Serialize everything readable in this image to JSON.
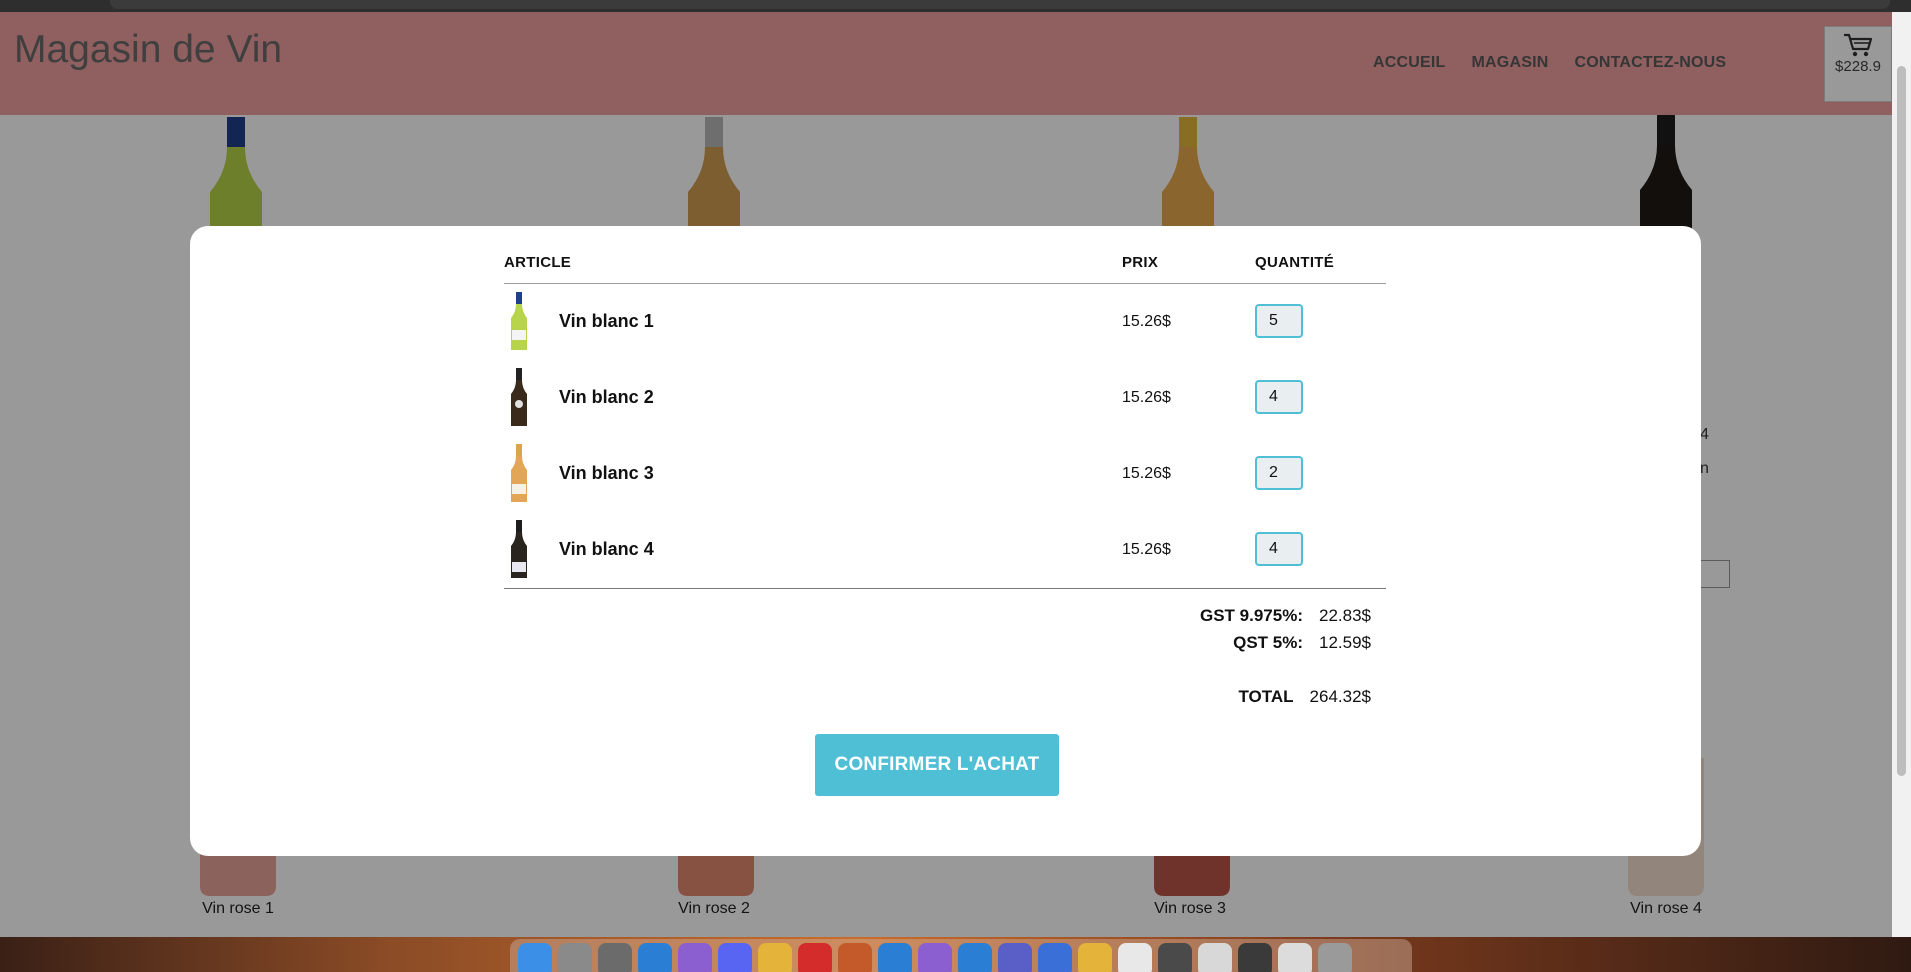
{
  "site": {
    "title": "Magasin de Vin",
    "nav": [
      "ACCUEIL",
      "MAGASIN",
      "CONTACTEZ-NOUS"
    ],
    "cart_total": "$228.9",
    "cart_icon": "shopping-cart-icon"
  },
  "background_products": [
    {
      "name": "Vin rose 1"
    },
    {
      "name": "Vin rose 2"
    },
    {
      "name": "Vin rose 3"
    },
    {
      "name": "Vin rose 4"
    }
  ],
  "background_fragments": [
    "4",
    "n"
  ],
  "modal": {
    "headers": {
      "article": "ARTICLE",
      "price": "PRIX",
      "quantity": "QUANTITÉ"
    },
    "items": [
      {
        "name": "Vin blanc 1",
        "price": "15.26$",
        "quantity": "5"
      },
      {
        "name": "Vin blanc 2",
        "price": "15.26$",
        "quantity": "4"
      },
      {
        "name": "Vin blanc 3",
        "price": "15.26$",
        "quantity": "2"
      },
      {
        "name": "Vin blanc 4",
        "price": "15.26$",
        "quantity": "4"
      }
    ],
    "taxes": [
      {
        "label": "GST 9.975%:",
        "value": "22.83$"
      },
      {
        "label": "QST 5%:",
        "value": "12.59$"
      }
    ],
    "total": {
      "label": "TOTAL",
      "value": "264.32$"
    },
    "confirm_label": "CONFIRMER L'ACHAT"
  },
  "colors": {
    "header_bg": "#f19ea0",
    "accent": "#4fbfd6",
    "overlay": "rgba(0,0,0,0.40)"
  }
}
